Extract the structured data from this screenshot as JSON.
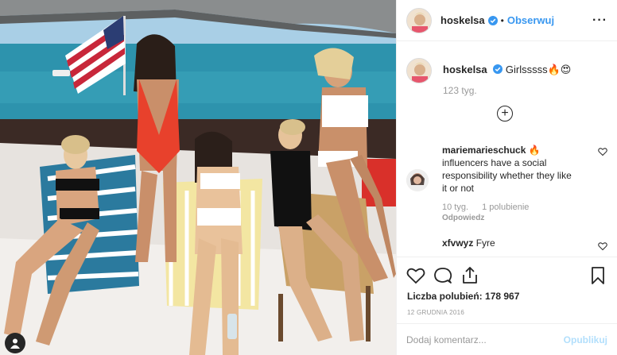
{
  "post": {
    "username": "hoskelsa",
    "follow_label": "Obserwuj",
    "dot": "•",
    "more_label": "···",
    "photo_description_icon": "photo"
  },
  "caption": {
    "username": "hoskelsa",
    "text": "Girlsssss🔥😍",
    "time": "123 tyg."
  },
  "load_more_label": "+",
  "comments": [
    {
      "username": "mariemarieschuck",
      "text": "🔥 influencers have a social responsibility whether they like it or not",
      "time": "10 tyg.",
      "likes": "1 polubienie",
      "reply_label": "Odpowiedz"
    },
    {
      "username": "xfvwyz",
      "text": "Fyre"
    }
  ],
  "actions": {
    "likes_label": "Liczba polubień:",
    "likes_count": "178 967",
    "date": "12 grudnia 2016"
  },
  "composer": {
    "placeholder": "Dodaj komentarz...",
    "publish_label": "Opublikuj"
  },
  "colors": {
    "link": "#3897f0",
    "publish_disabled": "#b2dffc",
    "verified": "#3897f0"
  },
  "icons": [
    "verified-icon",
    "heart-icon",
    "comment-icon",
    "share-icon",
    "bookmark-icon",
    "plus-icon",
    "profile-icon"
  ]
}
